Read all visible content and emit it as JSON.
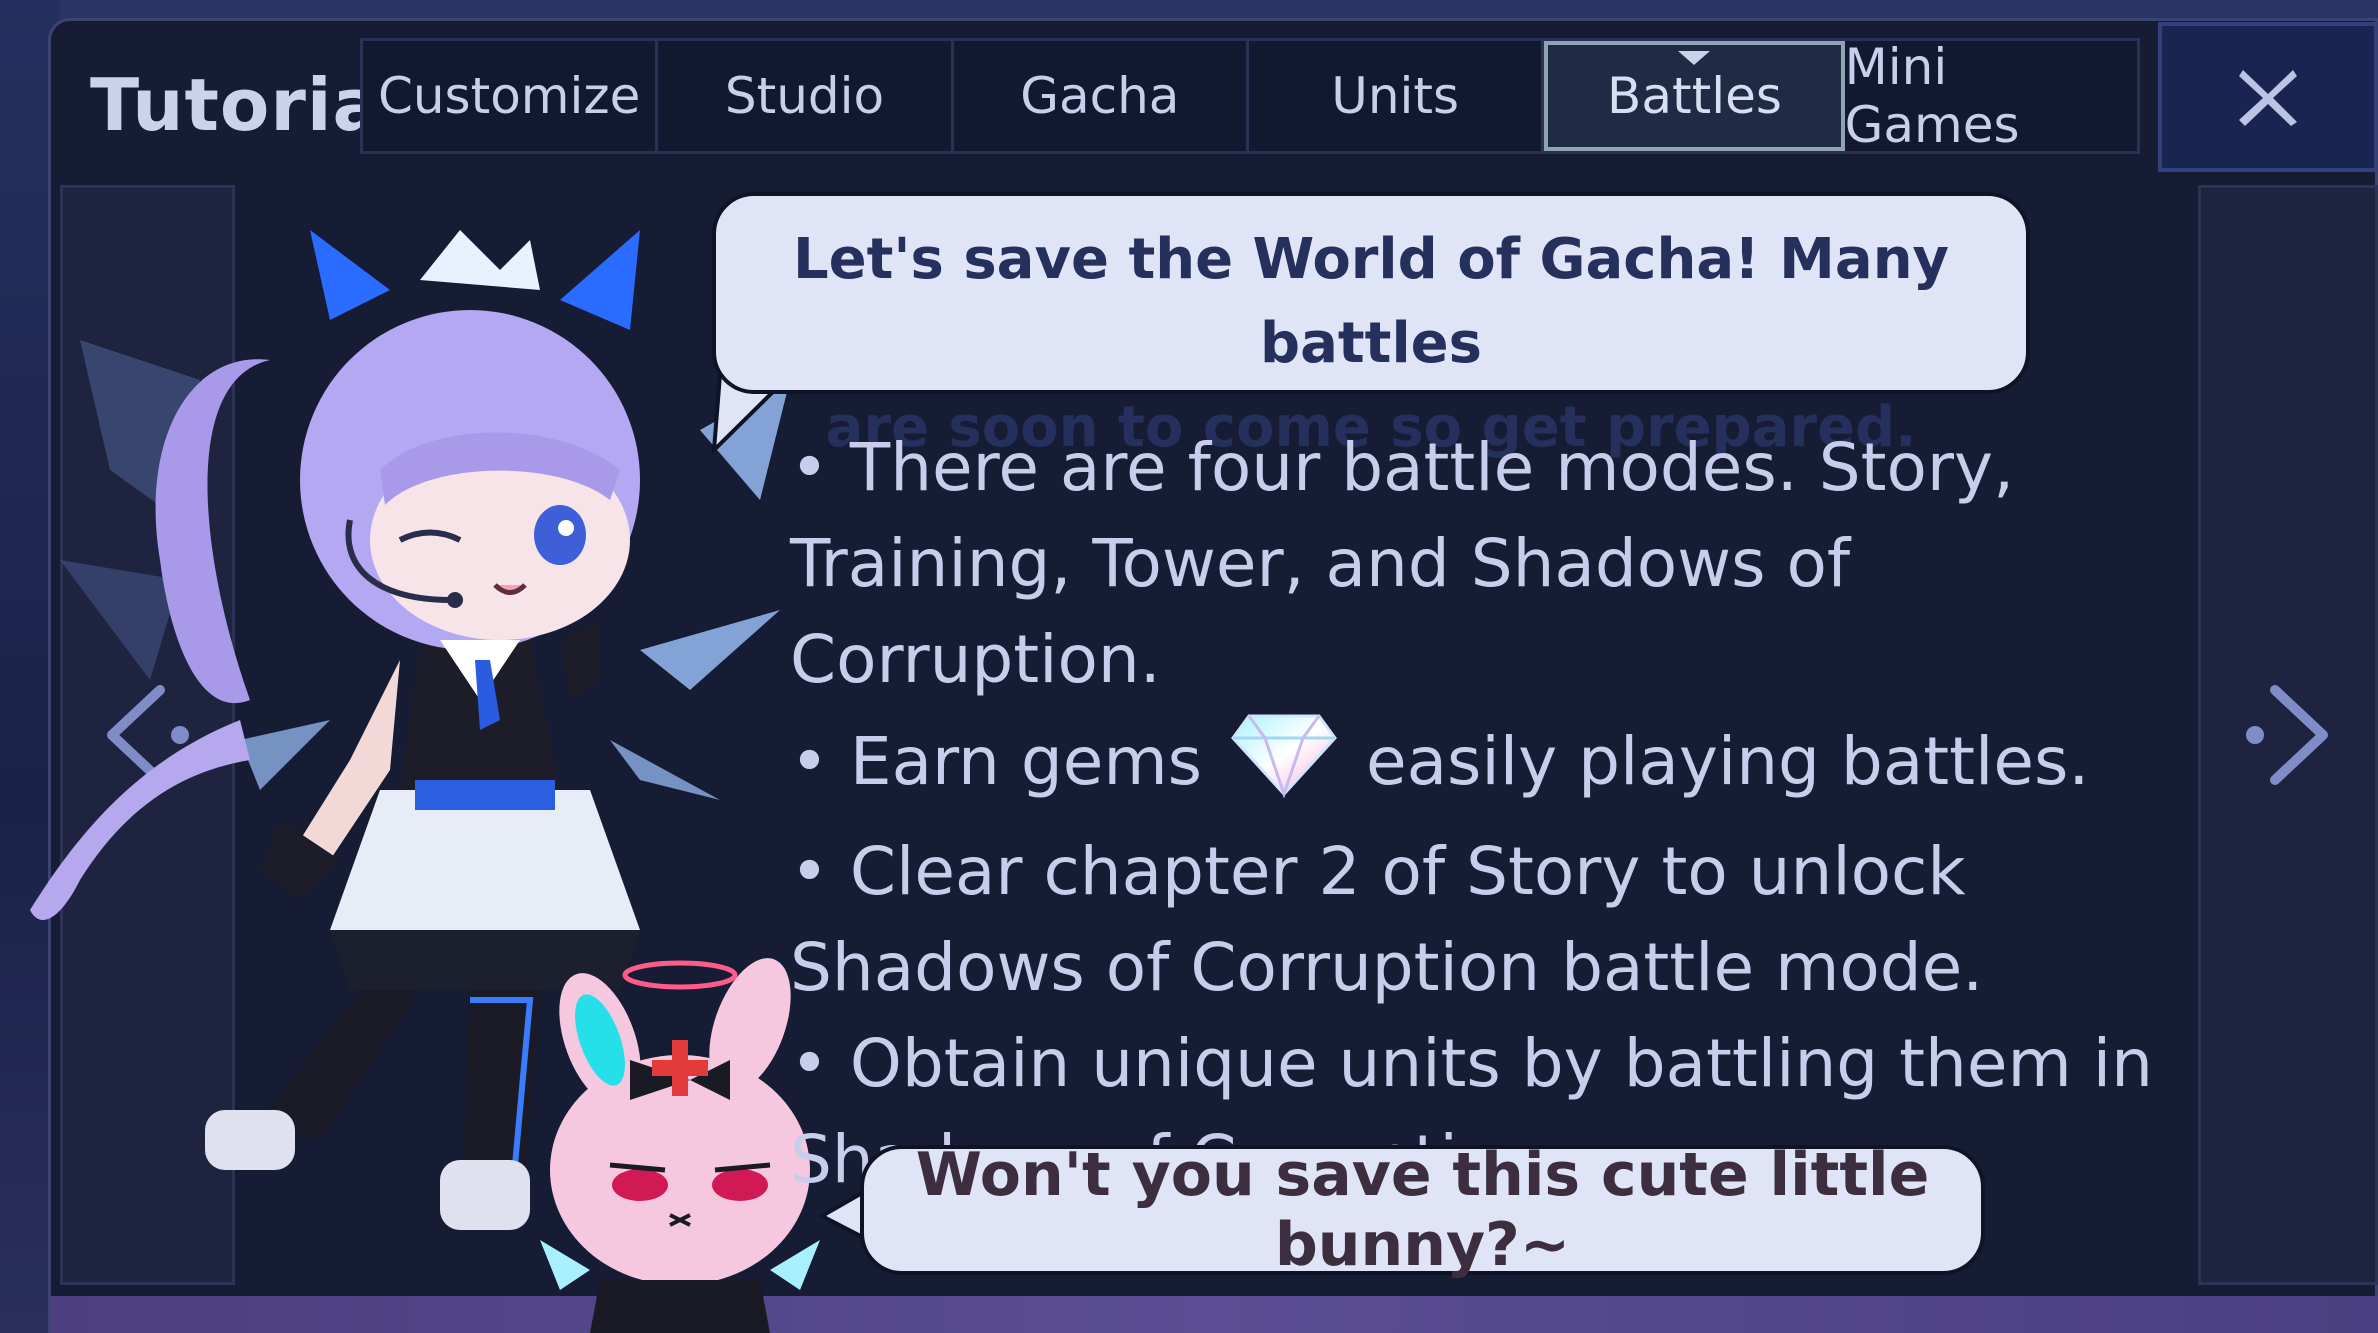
{
  "header": {
    "title": "Tutorial",
    "tabs": [
      {
        "label": "Customize"
      },
      {
        "label": "Studio"
      },
      {
        "label": "Gacha"
      },
      {
        "label": "Units"
      },
      {
        "label": "Battles"
      },
      {
        "label": "Mini Games"
      }
    ],
    "active_tab": "Battles",
    "close_label": "X"
  },
  "bubble_top": {
    "line1": "Let's save the World of Gacha! Many battles",
    "line2": "are soon to come so get prepared."
  },
  "content": {
    "bullet1": "• There are four battle modes. Story, Training, Tower, and Shadows of Corruption.",
    "bullet2_before": "• Earn gems",
    "bullet2_after": "easily playing battles.",
    "bullet3": "• Clear chapter 2 of Story to unlock Shadows of Corruption battle mode.",
    "bullet4": "• Obtain unique units by battling them in Shadows of Corruption."
  },
  "bubble_bottom": {
    "text": "Won't you save this cute little bunny?~"
  },
  "icons": {
    "gem": "gem-icon",
    "prev": "chevron-left-icon",
    "next": "chevron-right-icon",
    "close": "close-icon"
  },
  "colors": {
    "accent": "#3f66e0",
    "panel": "#161c34",
    "bubble": "#dfe5f7"
  }
}
